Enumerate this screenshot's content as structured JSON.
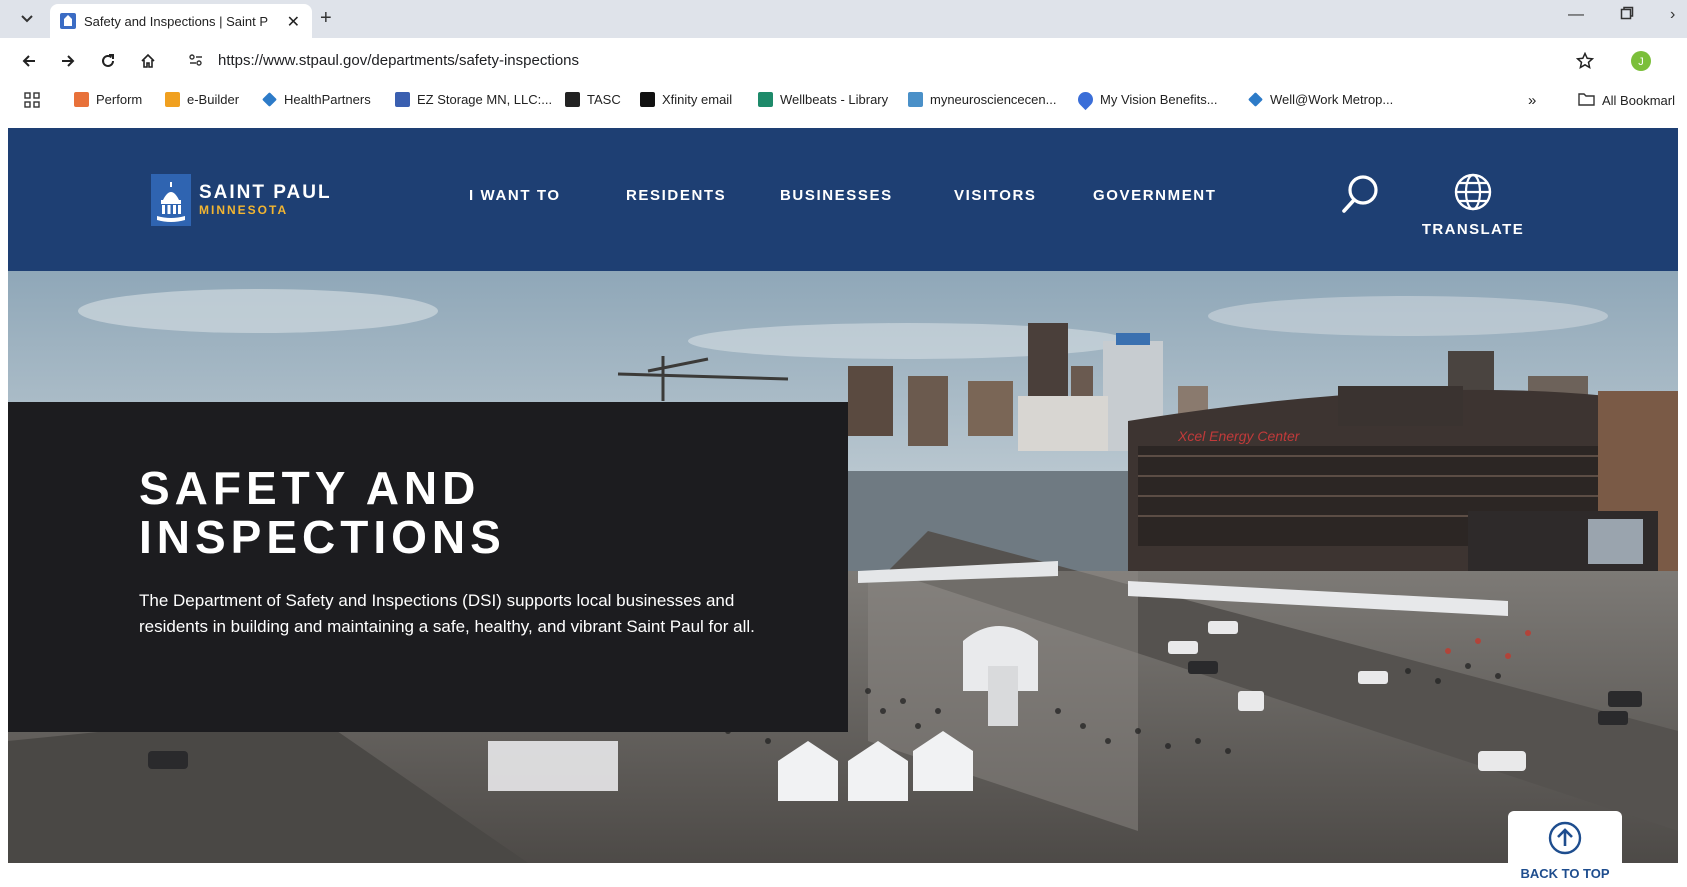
{
  "browser": {
    "tab_title": "Safety and Inspections | Saint P",
    "url": "https://www.stpaul.gov/departments/safety-inspections",
    "bookmarks": [
      {
        "label": "Perform",
        "color": "#e8713a"
      },
      {
        "label": "e-Builder",
        "color": "#f0a020"
      },
      {
        "label": "HealthPartners",
        "color": "#2d7bc8"
      },
      {
        "label": "EZ Storage MN, LLC:...",
        "color": "#3a5fb0"
      },
      {
        "label": "TASC",
        "color": "#222222"
      },
      {
        "label": "Xfinity email",
        "color": "#111111"
      },
      {
        "label": "Wellbeats - Library",
        "color": "#1e8a6a"
      },
      {
        "label": "myneurosciencecen...",
        "color": "#4a90c8"
      },
      {
        "label": "My Vision Benefits...",
        "color": "#3a6ed8"
      },
      {
        "label": "Well@Work Metrop...",
        "color": "#2d7bc8"
      }
    ],
    "all_bookmarks_label": "All Bookmarl",
    "profile_color": "#7bbf3a"
  },
  "site": {
    "logo_line1": "SAINT PAUL",
    "logo_line2": "MINNESOTA",
    "nav": [
      "I WANT TO",
      "RESIDENTS",
      "BUSINESSES",
      "VISITORS",
      "GOVERNMENT"
    ],
    "translate_label": "TRANSLATE",
    "header_color": "#1e3f73"
  },
  "hero": {
    "title_line1": "SAFETY AND",
    "title_line2": "INSPECTIONS",
    "description": "The Department of Safety and Inspections (DSI) supports local businesses and residents in building and maintaining a safe, healthy, and vibrant Saint Paul for all.",
    "arena_sign": "Xcel Energy Center"
  },
  "back_to_top_label": "BACK TO TOP"
}
